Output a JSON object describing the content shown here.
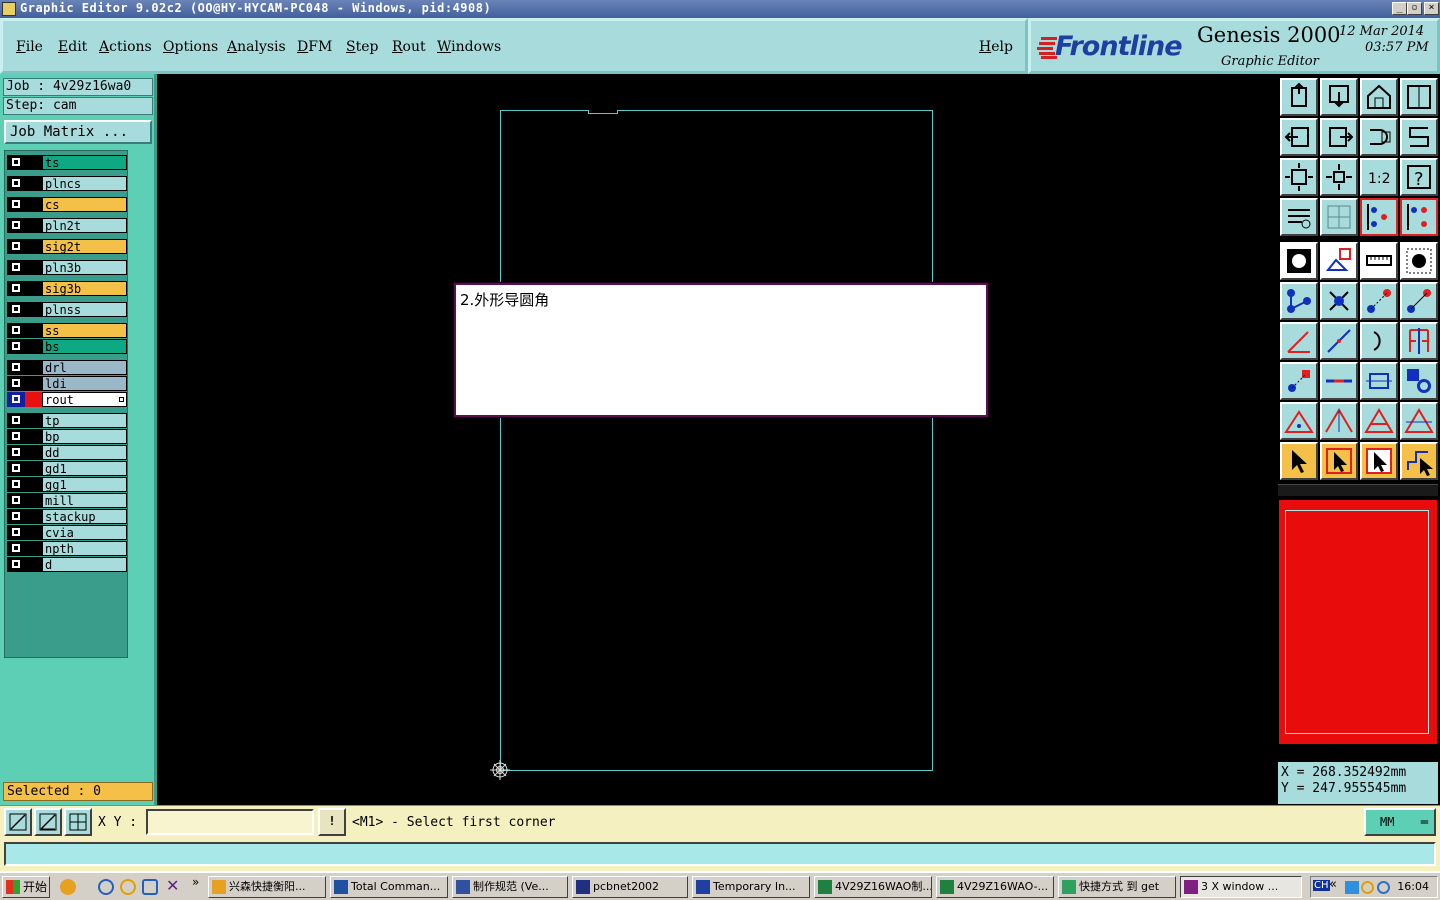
{
  "window": {
    "title": "Graphic Editor 9.02c2 (OO@HY-HYCAM-PC048 - Windows, pid:4908)"
  },
  "menu": {
    "items": [
      "File",
      "Edit",
      "Actions",
      "Options",
      "Analysis",
      "DFM",
      "Step",
      "Rout",
      "Windows"
    ],
    "help": "Help"
  },
  "brand": {
    "logo": "Frontline",
    "product": "Genesis 2000",
    "subtitle": "Graphic Editor",
    "date": "12 Mar 2014",
    "time": "03:57 PM"
  },
  "job": {
    "job_label": "Job : 4v29z16wa0",
    "step_label": "Step: cam",
    "matrix_button": "Job Matrix ..."
  },
  "layers": [
    {
      "name": "ts",
      "color": "#0ea882"
    },
    {
      "name": "plncs",
      "color": "#a8dcdc"
    },
    {
      "name": "cs",
      "color": "#f4c048"
    },
    {
      "name": "pln2t",
      "color": "#a8dcdc"
    },
    {
      "name": "sig2t",
      "color": "#f4c048"
    },
    {
      "name": "pln3b",
      "color": "#a8dcdc"
    },
    {
      "name": "sig3b",
      "color": "#f4c048"
    },
    {
      "name": "plnss",
      "color": "#a8dcdc"
    },
    {
      "name": "ss",
      "color": "#f4c048"
    },
    {
      "name": "bs",
      "color": "#0ea882"
    },
    {
      "name": "drl",
      "color": "#9ab8c8"
    },
    {
      "name": "ldi",
      "color": "#9ab8c8"
    },
    {
      "name": "rout",
      "color": "#ffffff"
    },
    {
      "name": "tp",
      "color": "#a8dcdc"
    },
    {
      "name": "bp",
      "color": "#a8dcdc"
    },
    {
      "name": "dd",
      "color": "#a8dcdc"
    },
    {
      "name": "gd1",
      "color": "#a8dcdc"
    },
    {
      "name": "gg1",
      "color": "#a8dcdc"
    },
    {
      "name": "mill",
      "color": "#a8dcdc"
    },
    {
      "name": "stackup",
      "color": "#a8dcdc"
    },
    {
      "name": "cvia",
      "color": "#a8dcdc"
    },
    {
      "name": "npth",
      "color": "#a8dcdc"
    },
    {
      "name": "d",
      "color": "#a8dcdc"
    }
  ],
  "selected": "Selected : 0",
  "popup": {
    "text": "2.外形导圆角"
  },
  "mini_map": {
    "background": "#e80c0c"
  },
  "coords": {
    "x": "X = 268.352492mm",
    "y": "Y = 247.955545mm"
  },
  "command": {
    "xy_label": "X Y :",
    "xy_value": "",
    "alert": "!",
    "prompt": "<M1> - Select first corner",
    "units": "MM"
  },
  "taskbar": {
    "start": "开始",
    "tasks": [
      "兴森快捷衡阳...",
      "Total Comman...",
      "制作规范 (Ve...",
      "pcbnet2002",
      "Temporary In...",
      "4V29Z16WAO制...",
      "4V29Z16WAO-...",
      "快捷方式 到 get",
      "3 X window ..."
    ],
    "tray_lang": "CH",
    "clock": "16:04"
  }
}
